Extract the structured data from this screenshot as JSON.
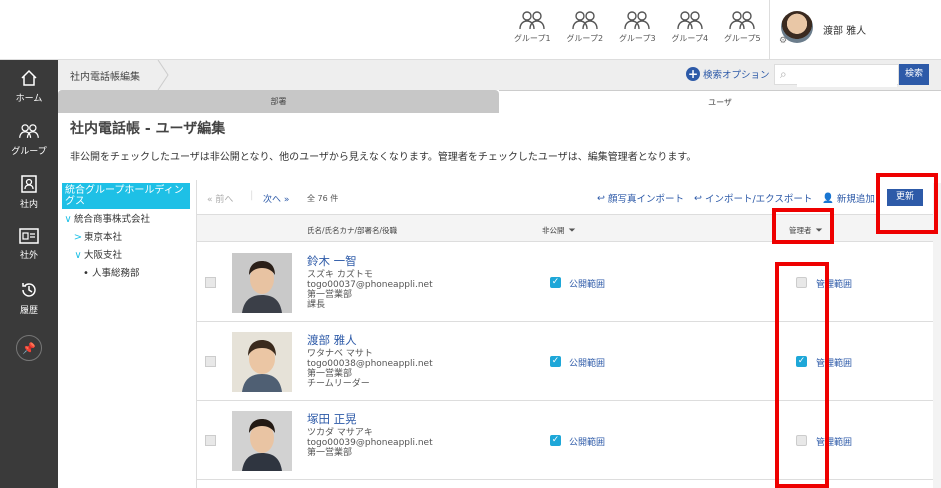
{
  "topbar": {
    "groups": [
      {
        "label": "グループ1"
      },
      {
        "label": "グループ2"
      },
      {
        "label": "グループ3"
      },
      {
        "label": "グループ4"
      },
      {
        "label": "グループ5"
      }
    ],
    "user_name": "渡部 雅人"
  },
  "sidebar": {
    "items": [
      {
        "label": "ホーム",
        "icon": "home-icon"
      },
      {
        "label": "グループ",
        "icon": "group-icon"
      },
      {
        "label": "社内",
        "icon": "company-book-icon"
      },
      {
        "label": "社外",
        "icon": "id-card-icon"
      },
      {
        "label": "履歴",
        "icon": "history-icon"
      }
    ]
  },
  "breadcrumb": {
    "current": "社内電話帳編集"
  },
  "search": {
    "option_label": "検索オプション",
    "button_label": "検索",
    "value": ""
  },
  "tabs": [
    {
      "label": "部署"
    },
    {
      "label": "ユーザ"
    }
  ],
  "page": {
    "title": "社内電話帳 - ユーザ編集",
    "description": "非公開をチェックしたユーザは非公開となり、他のユーザから見えなくなります。管理者をチェックしたユーザは、編集管理者となります。"
  },
  "tree": {
    "root": "統合グループホールディングス",
    "items": [
      {
        "label": "統合商事株式会社",
        "marker": "∨"
      },
      {
        "label": "東京本社",
        "marker": ">"
      },
      {
        "label": "大阪支社",
        "marker": "∨"
      },
      {
        "label": "人事総務部",
        "marker": "•"
      }
    ]
  },
  "toolbar": {
    "prev": "前へ",
    "next": "次へ",
    "count": "全 76 件",
    "photo_import": "顔写真インポート",
    "import_export": "インポート/エクスポート",
    "add_new": "新規追加",
    "update": "更新"
  },
  "table": {
    "headers": {
      "name": "氏名/氏名カナ/部署名/役職",
      "private": "非公開",
      "admin": "管理者"
    },
    "rows": [
      {
        "name": "鈴木 一智",
        "kana": "スズキ カズトモ",
        "email": "togo00037@phoneappli.net",
        "dept": "第一営業部",
        "title": "課長",
        "private_checked": true,
        "private_scope": "公開範囲",
        "admin_checked": false,
        "admin_scope": "管理範囲"
      },
      {
        "name": "渡部 雅人",
        "kana": "ワタナベ マサト",
        "email": "togo00038@phoneappli.net",
        "dept": "第一営業部",
        "title": "チームリーダー",
        "private_checked": true,
        "private_scope": "公開範囲",
        "admin_checked": true,
        "admin_scope": "管理範囲"
      },
      {
        "name": "塚田 正晃",
        "kana": "ツカダ マサアキ",
        "email": "togo00039@phoneappli.net",
        "dept": "第一営業部",
        "title": "",
        "private_checked": true,
        "private_scope": "公開範囲",
        "admin_checked": false,
        "admin_scope": "管理範囲"
      }
    ]
  },
  "colors": {
    "accent": "#2d5aa8",
    "tree_highlight": "#1ec0e6",
    "sidebar": "#3a3a3a",
    "highlight_box": "#e00000"
  }
}
